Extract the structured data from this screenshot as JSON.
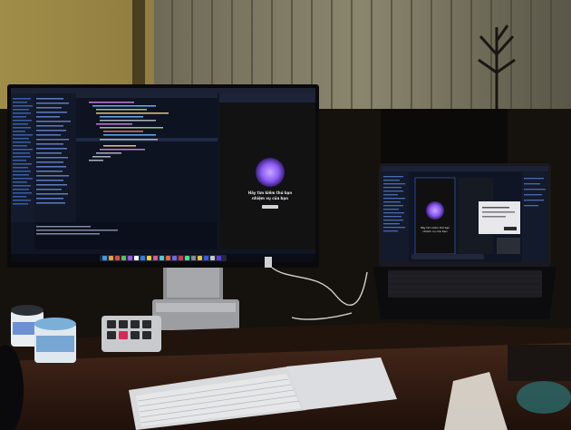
{
  "scene": {
    "description_items": [
      "external-monitor",
      "laptop",
      "keyboard",
      "trackpad",
      "macro-pad",
      "desk"
    ]
  },
  "monitor_screen": {
    "app_title": "",
    "preview_heading": "Hãy tìm kiếm thứ bạn",
    "preview_subheading": "nhiệm vụ của bạn",
    "preview_button": ""
  },
  "laptop_screen": {
    "preview_heading": "Hãy tìm kiếm thứ bạn",
    "preview_subheading": "nhiệm vụ của bạn"
  },
  "colors": {
    "wall": "#6b5a2e",
    "blinds": "#8a8468",
    "desk": "#3a1f14",
    "screen_bg": "#0f1524",
    "accent": "#8a5cf5",
    "keyboard": "#d9dadc"
  }
}
